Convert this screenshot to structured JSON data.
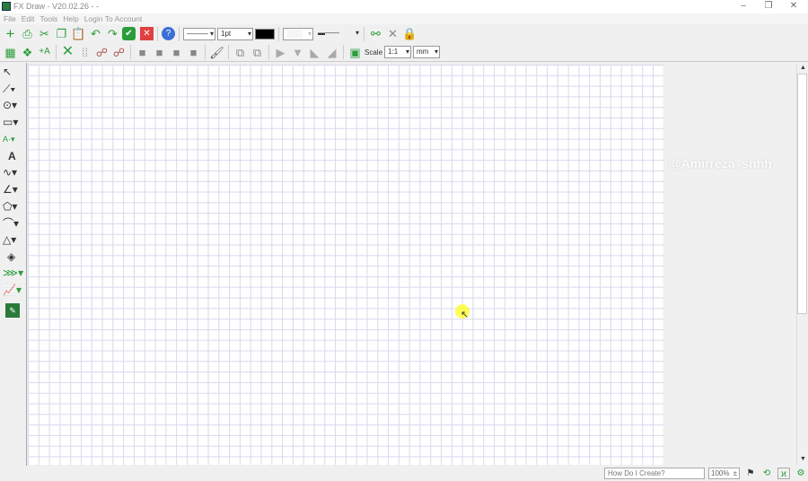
{
  "window": {
    "title": "FX Draw - V20.02.26 -  -",
    "minimize": "–",
    "restore": "❐",
    "close": "✕"
  },
  "menu": [
    "File",
    "Edit",
    "Tools",
    "Help",
    "Login To Account"
  ],
  "toolbar1": {
    "icons": [
      "new-icon",
      "print-icon",
      "cut-icon",
      "copy-icon",
      "paste-icon",
      "undo-icon",
      "redo-icon",
      "accept-icon",
      "cancel-icon",
      "help-icon"
    ],
    "line_style": "———",
    "line_width": "1pt",
    "line_color": "#000000",
    "fill_pattern": "░░░",
    "arrow_style": "▬——",
    "icons_right": [
      "link-icon",
      "unlink-icon",
      "lock-icon"
    ]
  },
  "toolbar2": {
    "icons": [
      "grid-icon",
      "snap-grid-icon",
      "label-icon",
      "delete-icon",
      "dots-grid-icon",
      "select-point-icon",
      "select-multi-icon",
      "bring-front-icon",
      "bring-forward-icon",
      "send-backward-icon",
      "send-back-icon",
      "format-painter-icon",
      "group-icon",
      "ungroup-icon",
      "align-left-icon",
      "align-top-icon",
      "flip-icon",
      "rotate-icon",
      "fit-page-icon"
    ],
    "scale_label": "Scale",
    "scale_value": "1:1",
    "unit": "mm"
  },
  "palette": [
    "pointer-icon",
    "line-tool-icon",
    "circle-tool-icon",
    "rectangle-tool-icon",
    "point-label-tool-icon",
    "text-tool-icon",
    "curve-tool-icon",
    "angle-tool-icon",
    "polygon-tool-icon",
    "arc-tool-icon",
    "triangle-tool-icon",
    "fill-tool-icon",
    "vector-tool-icon",
    "graph-tool-icon",
    "fxsm-icon"
  ],
  "watermark": "@Amirreza_shhh",
  "status": {
    "help_placeholder": "How Do I Create?",
    "zoom": "100%",
    "icons": [
      "flag-icon",
      "history-icon",
      "graph-mode-icon",
      "settings-icon"
    ]
  },
  "colors": {
    "accent_green": "#2a9d3a",
    "cancel_red": "#e04040",
    "help_blue": "#3a6fd8"
  }
}
